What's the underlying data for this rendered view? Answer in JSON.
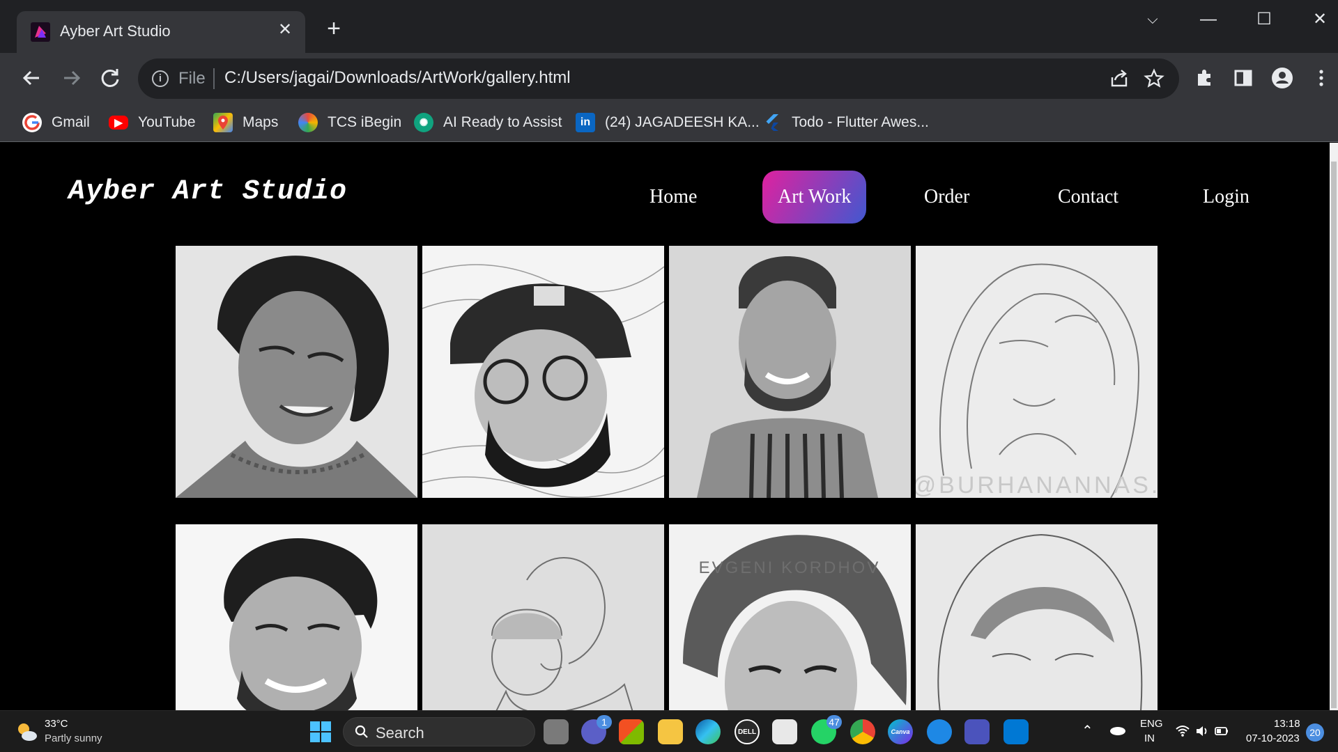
{
  "browser": {
    "tab_title": "Ayber Art Studio",
    "tab_close": "✕",
    "new_tab": "+",
    "scheme_label": "File",
    "url": "C:/Users/jagai/Downloads/ArtWork/gallery.html",
    "window_controls": {
      "dropdown": "⌵",
      "minimize": "—",
      "maximize": "☐",
      "close": "✕"
    },
    "bookmarks": [
      {
        "label": "Gmail",
        "icon": "google-icon",
        "color": "#4285f4"
      },
      {
        "label": "YouTube",
        "icon": "youtube-icon",
        "color": "#ff0000"
      },
      {
        "label": "Maps",
        "icon": "maps-icon",
        "color": "#34a853"
      },
      {
        "label": "TCS iBegin",
        "icon": "tcs-icon",
        "color": "#6b4ea0"
      },
      {
        "label": "AI Ready to Assist",
        "icon": "openai-icon",
        "color": "#10a37f"
      },
      {
        "label": "(24) JAGADEESH KA...",
        "icon": "linkedin-icon",
        "color": "#0a66c2"
      },
      {
        "label": "Todo - Flutter Awes...",
        "icon": "flutter-icon",
        "color": "#42a5f5"
      }
    ]
  },
  "site": {
    "title": "Ayber Art Studio",
    "nav": [
      {
        "label": "Home",
        "active": false
      },
      {
        "label": "Art Work",
        "active": true
      },
      {
        "label": "Order",
        "active": false
      },
      {
        "label": "Contact",
        "active": false
      },
      {
        "label": "Login",
        "active": false
      }
    ],
    "gallery_captions": {
      "tile4": "@BURHANANNAS.",
      "tile7": "EVGENI KORDHOV"
    }
  },
  "taskbar": {
    "weather_temp": "33°C",
    "weather_desc": "Partly sunny",
    "search_label": "Search",
    "teams_badge": "1",
    "whatsapp_badge": "47",
    "canva_label": "Canva",
    "dell_label": "DELL",
    "lang_top": "ENG",
    "lang_bottom": "IN",
    "time": "13:18",
    "date": "07-10-2023",
    "notifications": "20"
  }
}
